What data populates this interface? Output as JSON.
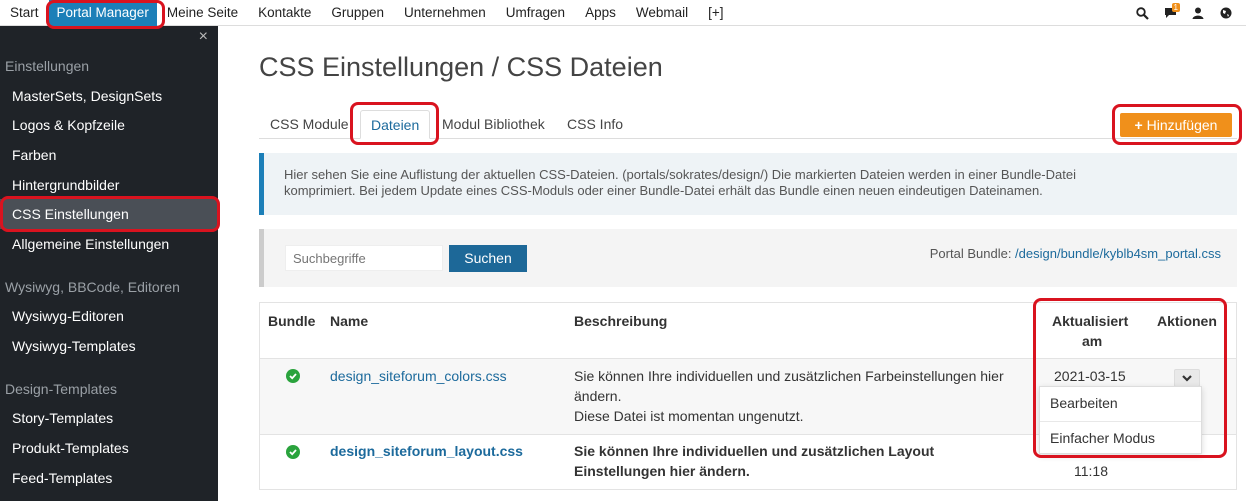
{
  "topnav": {
    "items": [
      "Start",
      "Portal Manager",
      "Meine Seite",
      "Kontakte",
      "Gruppen",
      "Unternehmen",
      "Umfragen",
      "Apps",
      "Webmail",
      "[+]"
    ],
    "active_index": 1,
    "notification_count": "1",
    "icons": [
      "search-icon",
      "comment-icon",
      "user-icon",
      "globe-icon"
    ]
  },
  "sidebar": {
    "close": "×",
    "sections": [
      {
        "title": "Einstellungen",
        "items": [
          "MasterSets, DesignSets",
          "Logos & Kopfzeile",
          "Farben",
          "Hintergrundbilder",
          "CSS Einstellungen",
          "Allgemeine Einstellungen"
        ]
      },
      {
        "title": "Wysiwyg, BBCode, Editoren",
        "items": [
          "Wysiwyg-Editoren",
          "Wysiwyg-Templates"
        ]
      },
      {
        "title": "Design-Templates",
        "items": [
          "Story-Templates",
          "Produkt-Templates",
          "Feed-Templates"
        ]
      }
    ],
    "active_item": "CSS Einstellungen"
  },
  "page": {
    "title": "CSS Einstellungen / CSS Dateien",
    "tabs": [
      "CSS Module",
      "Dateien",
      "Modul Bibliothek",
      "CSS Info"
    ],
    "active_tab": "Dateien",
    "add_button": "Hinzufügen",
    "info_line1": "Hier sehen Sie eine Auflistung der aktuellen CSS-Dateien. (portals/sokrates/design/) Die markierten Dateien werden in einer Bundle-Datei",
    "info_line2": "komprimiert. Bei jedem Update eines CSS-Moduls oder einer Bundle-Datei erhält das Bundle einen neuen eindeutigen Dateinamen.",
    "search_placeholder": "Suchbegriffe",
    "search_button": "Suchen",
    "bundle_label": "Portal Bundle: ",
    "bundle_link": "/design/bundle/kyblb4sm_portal.css"
  },
  "table": {
    "headers": {
      "bundle": "Bundle",
      "name": "Name",
      "desc": "Beschreibung",
      "updated1": "Aktualisiert",
      "updated2": "am",
      "actions": "Aktionen"
    },
    "rows": [
      {
        "name": "design_siteforum_colors.css",
        "desc1": "Sie können Ihre individuellen und zusätzlichen Farbeinstellungen hier",
        "desc2": "ändern.",
        "desc3": "Diese Datei ist momentan ungenutzt.",
        "date": "2021-03-15"
      },
      {
        "name": "design_siteforum_layout.css",
        "desc1": "Sie können Ihre individuellen und zusätzlichen Layout",
        "desc2": "Einstellungen hier ändern.",
        "time": "11:18"
      }
    ]
  },
  "dropdown": {
    "items": [
      "Bearbeiten",
      "Einfacher Modus"
    ]
  },
  "colors": {
    "accent": "#1c7fb8",
    "orange": "#f0901b",
    "annotation": "#d9131f",
    "check": "#2aa33d"
  }
}
